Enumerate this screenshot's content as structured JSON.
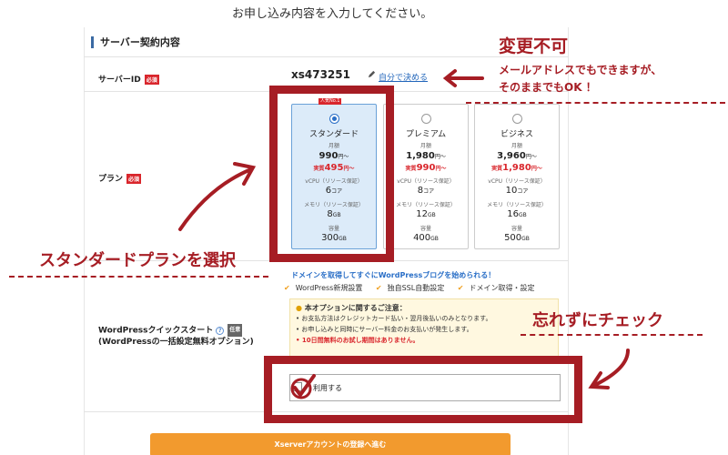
{
  "top_message": "お申し込み内容を入力してください。",
  "section_title": "サーバー契約内容",
  "server_id": {
    "label": "サーバーID",
    "required_badge": "必須",
    "value": "xs473251",
    "link": "自分で決める"
  },
  "plan": {
    "label": "プラン",
    "required_badge": "必須",
    "popular_badge": "人気No.1",
    "cards": [
      {
        "name": "スタンダード",
        "monthly_label": "月額",
        "price": "990",
        "price_unit": "円～",
        "sale_label": "実質",
        "sale": "495",
        "sale_unit": "円～",
        "cpu_label": "vCPU（リソース保証）",
        "cpu": "6",
        "cpu_unit": "コア",
        "mem_label": "メモリ（リソース保証）",
        "mem": "8",
        "mem_unit": "GB",
        "disk_label": "容量",
        "disk": "300",
        "disk_unit": "GB",
        "selected": true
      },
      {
        "name": "プレミアム",
        "monthly_label": "月額",
        "price": "1,980",
        "price_unit": "円～",
        "sale_label": "実質",
        "sale": "990",
        "sale_unit": "円～",
        "cpu_label": "vCPU（リソース保証）",
        "cpu": "8",
        "cpu_unit": "コア",
        "mem_label": "メモリ（リソース保証）",
        "mem": "12",
        "mem_unit": "GB",
        "disk_label": "容量",
        "disk": "400",
        "disk_unit": "GB",
        "selected": false
      },
      {
        "name": "ビジネス",
        "monthly_label": "月額",
        "price": "3,960",
        "price_unit": "円～",
        "sale_label": "実質",
        "sale": "1,980",
        "sale_unit": "円～",
        "cpu_label": "vCPU（リソース保証）",
        "cpu": "10",
        "cpu_unit": "コア",
        "mem_label": "メモリ（リソース保証）",
        "mem": "16",
        "mem_unit": "GB",
        "disk_label": "容量",
        "disk": "500",
        "disk_unit": "GB",
        "selected": false
      }
    ]
  },
  "wp": {
    "label_line1": "WordPressクイックスタート",
    "label_line2": "(WordPressの一括設定無料オプション)",
    "optional_badge": "任意",
    "promo": "ドメインを取得してすぐにWordPressブログを始められる！",
    "features": [
      "WordPress新規設置",
      "独自SSL自動設定",
      "ドメイン取得・設定"
    ],
    "notice_title": "本オプションに関するご注意：",
    "notices": [
      "お支払方法はクレジットカード払い・翌月後払いのみとなります。",
      "お申し込みと同時にサーバー料金のお支払いが発生します。"
    ],
    "notice_red": "10日間無料のお試し期間はありません。",
    "use_label": "利用する"
  },
  "submit_label": "Xserverアカウントの登録へ進む",
  "annotations": {
    "no_change": "変更不可",
    "email_line1": "メールアドレスでもできますが、",
    "email_line2": "そのままでもOK ！",
    "select_standard": "スタンダードプランを選択",
    "dont_forget": "忘れずにチェック"
  },
  "colors": {
    "accent_red": "#a61d24",
    "link_blue": "#2266bb",
    "submit_orange": "#f29a2e"
  }
}
